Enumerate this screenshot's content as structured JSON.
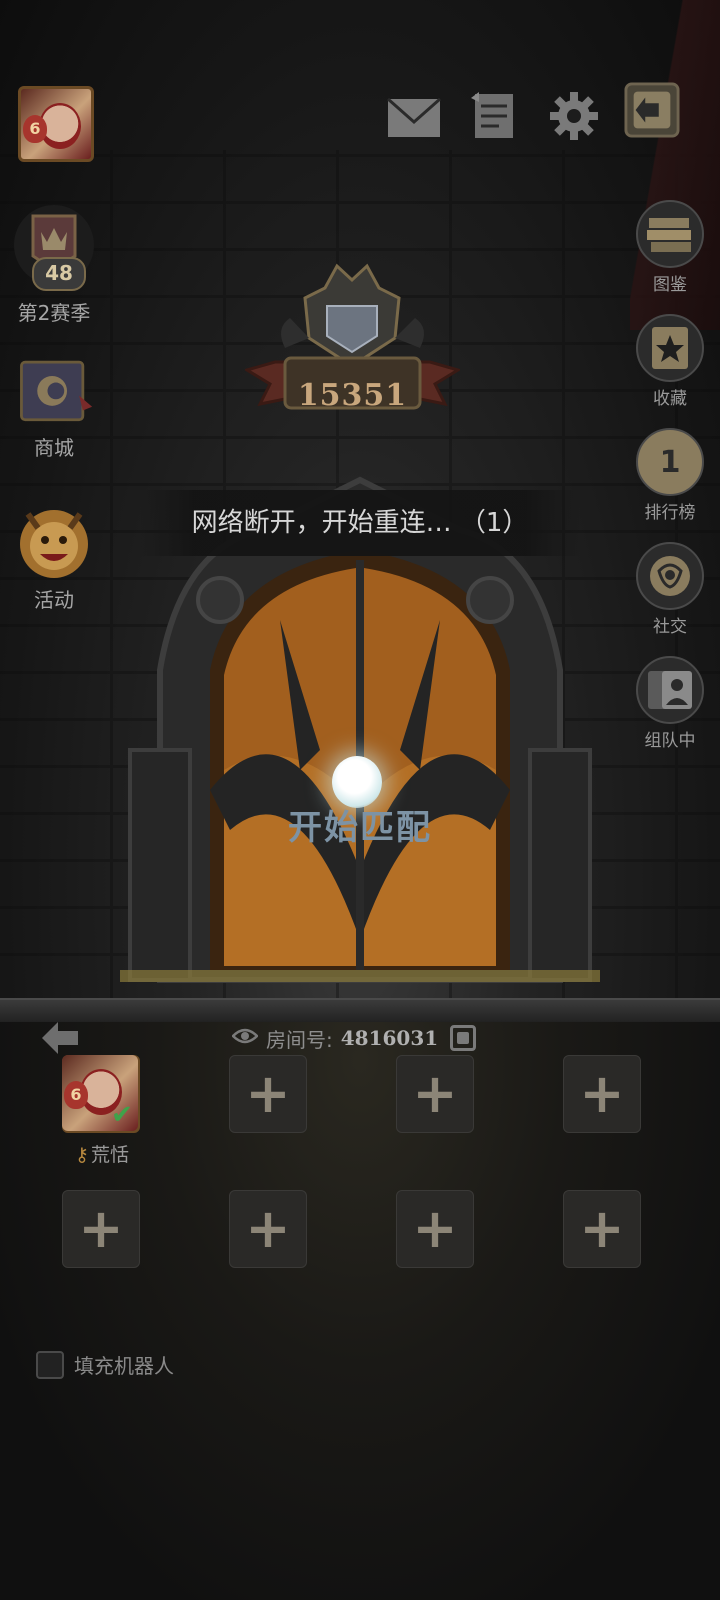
{
  "top_bar": {
    "avatar_level": "6",
    "icons": [
      "mail-icon",
      "notes-icon",
      "gear-icon",
      "exit-icon"
    ]
  },
  "left_menu": {
    "season": {
      "level": "48",
      "label": "第2赛季"
    },
    "shop": {
      "label": "商城"
    },
    "events": {
      "label": "活动"
    }
  },
  "right_menu": {
    "codex": {
      "label": "图鉴"
    },
    "collection": {
      "label": "收藏"
    },
    "leaderboard": {
      "label": "排行榜",
      "badge": "1"
    },
    "social": {
      "label": "社交"
    },
    "party": {
      "label": "组队中"
    }
  },
  "rank": {
    "score": "15351"
  },
  "toast": {
    "message": "网络断开，开始重连… （1）"
  },
  "match": {
    "button_label": "开始匹配"
  },
  "room": {
    "label": "房间号:",
    "number": "4816031"
  },
  "party": {
    "player": {
      "name": "荒恬",
      "level": "6"
    },
    "empty_slot_symbol": "+"
  },
  "fill_bots": {
    "label": "填充机器人",
    "checked": false
  }
}
